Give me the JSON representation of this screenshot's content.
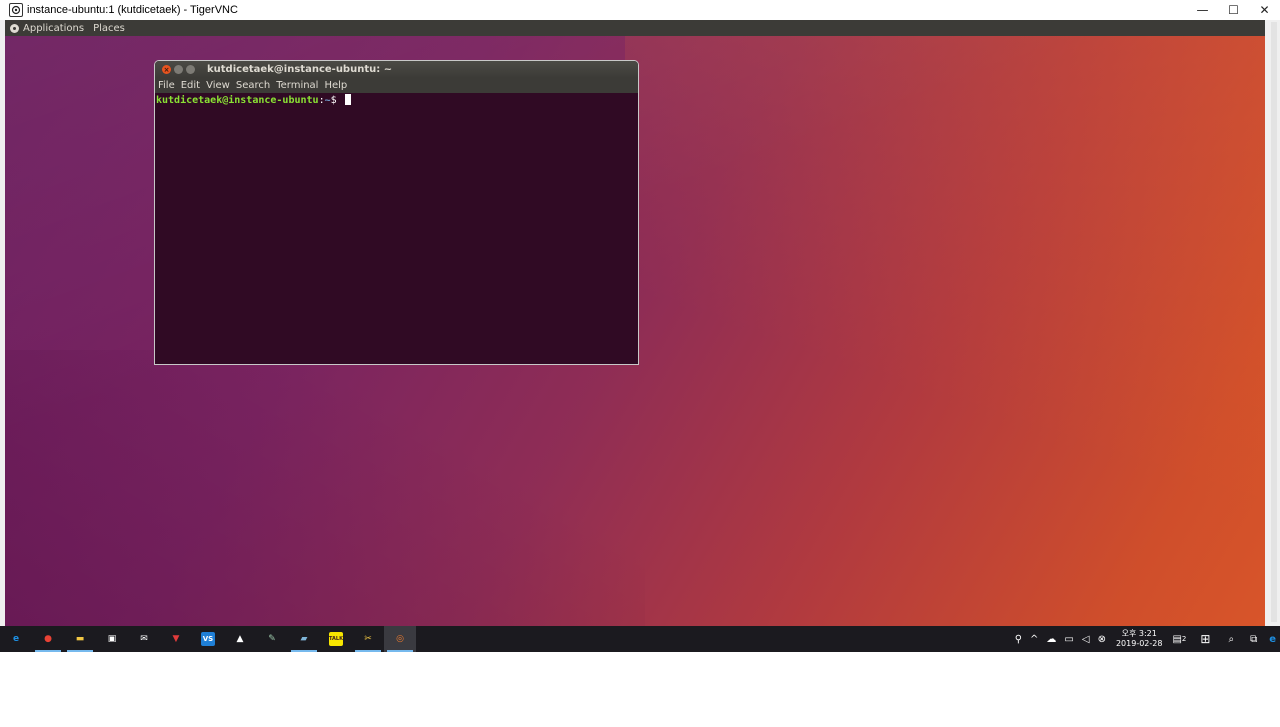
{
  "window": {
    "title": "instance-ubuntu:1 (kutdicetaek) - TigerVNC",
    "controls": {
      "minimize": "—",
      "maximize": "☐",
      "close": "✕"
    }
  },
  "panel": {
    "applications": "Applications",
    "places": "Places"
  },
  "terminal": {
    "title": "kutdicetaek@instance-ubuntu: ~",
    "menu": [
      "File",
      "Edit",
      "View",
      "Search",
      "Terminal",
      "Help"
    ],
    "prompt_user": "kutdicetaek@instance-ubuntu",
    "prompt_sep": ":",
    "prompt_path": "~",
    "prompt_symbol": "$",
    "close_glyph": "×"
  },
  "taskbar": {
    "icons": [
      {
        "name": "edge-icon",
        "glyph": "e",
        "color": "#1e8fe1"
      },
      {
        "name": "chrome-icon",
        "glyph": "●",
        "color": "#e94235"
      },
      {
        "name": "file-explorer-icon",
        "glyph": "▬",
        "color": "#f2c744"
      },
      {
        "name": "store-icon",
        "glyph": "▣",
        "color": "#ffffff"
      },
      {
        "name": "mail-icon",
        "glyph": "✉",
        "color": "#ffffff"
      },
      {
        "name": "shield-app-icon",
        "glyph": "▼",
        "color": "#e13b3b"
      },
      {
        "name": "vscode-icon",
        "glyph": "VS",
        "color": "#1f7fd6"
      },
      {
        "name": "photos-icon",
        "glyph": "▲",
        "color": "#ffffff"
      },
      {
        "name": "sketch-app-icon",
        "glyph": "✎",
        "color": "#9cc7a9"
      },
      {
        "name": "notes-app-icon",
        "glyph": "▰",
        "color": "#7fb5d8"
      },
      {
        "name": "kakaotalk-icon",
        "glyph": "TALK",
        "color": "#f7e600"
      },
      {
        "name": "tools-app-icon",
        "glyph": "✂",
        "color": "#f2c744"
      },
      {
        "name": "tigervnc-icon",
        "glyph": "◎",
        "color": "#f07c2e"
      }
    ],
    "tray": {
      "clock_time": "오후 3:21",
      "clock_date": "2019-02-28",
      "notification_count": "2"
    }
  }
}
